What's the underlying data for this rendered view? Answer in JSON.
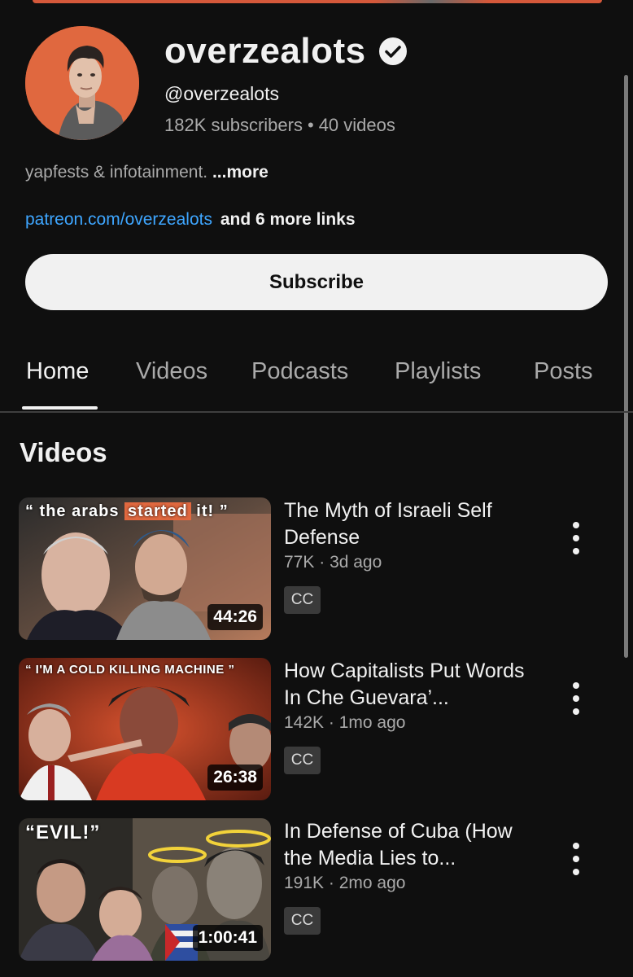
{
  "channel": {
    "name": "overzealots",
    "handle": "@overzealots",
    "subscribers": "182K subscribers",
    "videos_count": "40 videos",
    "separator": "•",
    "description": "yapfests & infotainment.",
    "description_more": "...more",
    "link": "patreon.com/overzealots",
    "more_links": "and 6 more links",
    "subscribe_label": "Subscribe"
  },
  "tabs": [
    {
      "label": "Home",
      "active": true
    },
    {
      "label": "Videos"
    },
    {
      "label": "Podcasts"
    },
    {
      "label": "Playlists"
    },
    {
      "label": "Posts"
    }
  ],
  "section": {
    "title": "Videos"
  },
  "videos": [
    {
      "title": "The Myth of Israeli Self Defense",
      "views": "77K",
      "age": "3d ago",
      "meta_sep": "·",
      "cc": "CC",
      "duration": "44:26",
      "thumb_text_a": "“ the arabs ",
      "thumb_text_hl": "started",
      "thumb_text_b": " it! ”"
    },
    {
      "title": "How Capitalists Put Words In Che Guevara’...",
      "views": "142K",
      "age": "1mo ago",
      "meta_sep": "·",
      "cc": "CC",
      "duration": "26:38",
      "thumb_text": "“ I'M A COLD KILLING MACHINE ”"
    },
    {
      "title": "In Defense of Cuba (How the Media Lies to...",
      "views": "191K",
      "age": "2mo ago",
      "meta_sep": "·",
      "cc": "CC",
      "duration": "1:00:41",
      "thumb_text": "“EVIL!”"
    }
  ],
  "colors": {
    "background": "#0f0f0f",
    "accent_orange": "#e0683f",
    "link_blue": "#3ea6ff",
    "muted_text": "#aaaaaa"
  }
}
